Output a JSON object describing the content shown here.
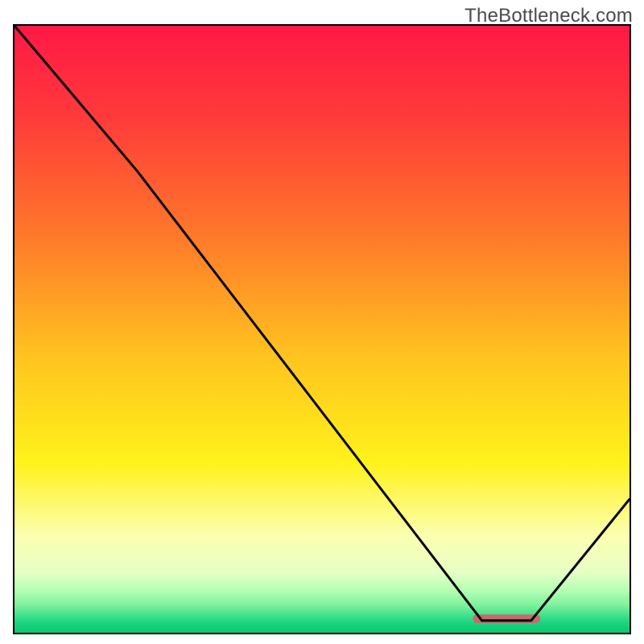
{
  "watermark": "TheBottleneck.com",
  "chart_data": {
    "type": "line",
    "title": "",
    "xlabel": "",
    "ylabel": "",
    "xlim": [
      0,
      100
    ],
    "ylim": [
      0,
      100
    ],
    "grid": false,
    "legend": null,
    "series": [
      {
        "name": "curve",
        "color": "#000000",
        "x": [
          0,
          20,
          76,
          84,
          100
        ],
        "y": [
          100,
          76,
          2,
          2,
          22
        ]
      }
    ],
    "annotations": [
      {
        "name": "marker-bar",
        "type": "bar",
        "x0": 74.5,
        "x1": 85.5,
        "y": 2.3,
        "height": 1.4,
        "color": "#c66a6a"
      }
    ],
    "background": {
      "type": "vertical-gradient",
      "stops": [
        {
          "pos": 0.0,
          "color": "#ff1846"
        },
        {
          "pos": 0.15,
          "color": "#ff3a3a"
        },
        {
          "pos": 0.35,
          "color": "#ff7a2a"
        },
        {
          "pos": 0.55,
          "color": "#ffc51f"
        },
        {
          "pos": 0.72,
          "color": "#fff21a"
        },
        {
          "pos": 0.84,
          "color": "#fcffb0"
        },
        {
          "pos": 0.9,
          "color": "#e7ffc4"
        },
        {
          "pos": 0.93,
          "color": "#b4ffb4"
        },
        {
          "pos": 0.955,
          "color": "#7df09c"
        },
        {
          "pos": 0.972,
          "color": "#3fe18b"
        },
        {
          "pos": 0.985,
          "color": "#18d37e"
        },
        {
          "pos": 1.0,
          "color": "#0cc773"
        }
      ]
    }
  }
}
